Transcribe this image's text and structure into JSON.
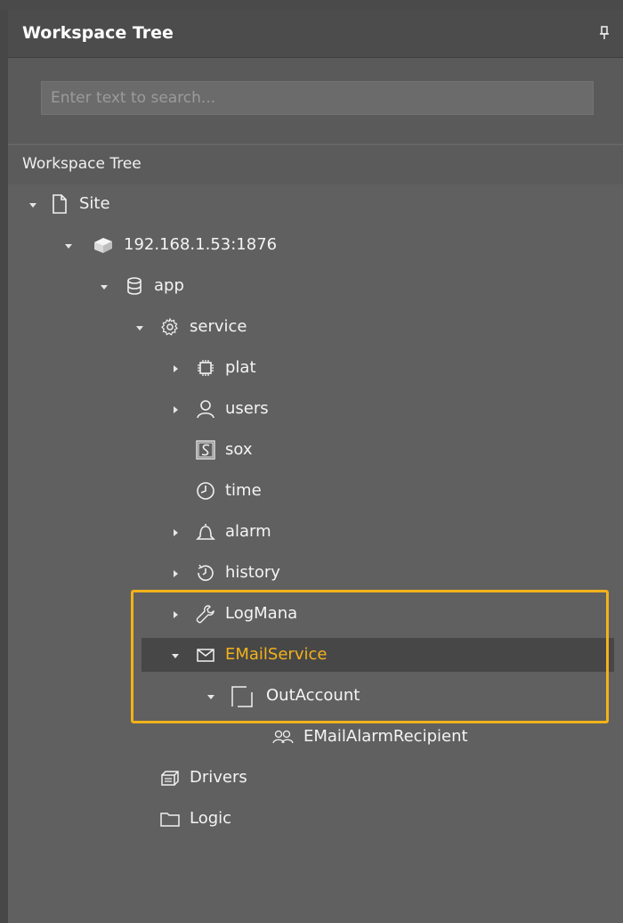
{
  "panel": {
    "title": "Workspace Tree",
    "search_placeholder": "Enter text to search...",
    "tree_header": "Workspace Tree"
  },
  "tree": {
    "site": "Site",
    "device": "192.168.1.53:1876",
    "app": "app",
    "service": "service",
    "plat": "plat",
    "users": "users",
    "sox": "sox",
    "time": "time",
    "alarm": "alarm",
    "history": "history",
    "logmana": "LogMana",
    "emailservice": "EMailService",
    "outaccount": "OutAccount",
    "emailalarmrecipient": "EMailAlarmRecipient",
    "drivers": "Drivers",
    "logic": "Logic"
  },
  "colors": {
    "selected_text": "#f3b21b",
    "highlight_border": "#f2b219",
    "panel_bg": "#606060",
    "title_bg": "#4c4c4c"
  }
}
